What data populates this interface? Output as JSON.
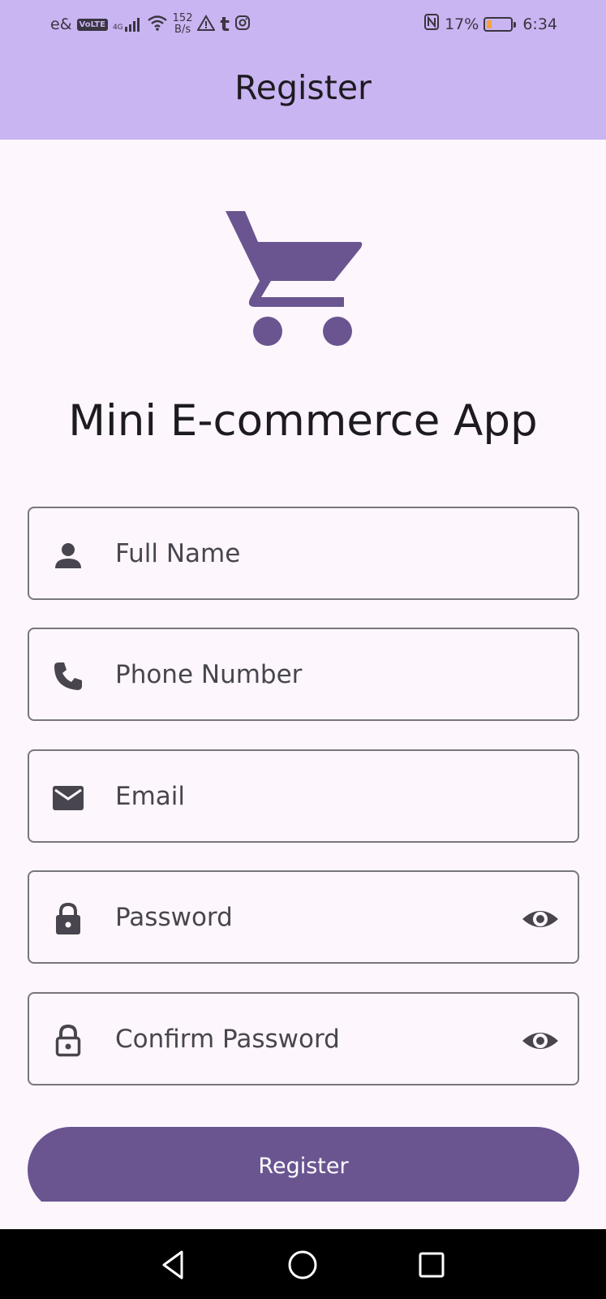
{
  "status_bar": {
    "carrier": "e&",
    "volte": "VoLTE",
    "network": "4G",
    "net_speed_value": "152",
    "net_speed_unit": "B/s",
    "battery_percent": "17%",
    "battery_level": 0.17,
    "time": "6:34",
    "icons": [
      "signal-icon",
      "wifi-icon",
      "warning-icon",
      "tumblr-icon",
      "instagram-icon",
      "nfc-icon",
      "battery-icon"
    ]
  },
  "app_bar": {
    "title": "Register"
  },
  "header": {
    "logo_icon": "shopping-cart-icon",
    "app_name": "Mini E-commerce App"
  },
  "form": {
    "full_name": {
      "placeholder": "Full Name",
      "icon": "person-icon"
    },
    "phone": {
      "placeholder": "Phone Number",
      "icon": "phone-icon"
    },
    "email": {
      "placeholder": "Email",
      "icon": "email-icon"
    },
    "password": {
      "placeholder": "Password",
      "icon": "lock-icon",
      "toggle_icon": "eye-icon"
    },
    "confirm_password": {
      "placeholder": "Confirm Password",
      "icon": "lock-outline-icon",
      "toggle_icon": "eye-icon"
    },
    "submit_label": "Register"
  },
  "colors": {
    "app_bar": "#c9b5f2",
    "background": "#fdf7fd",
    "primary": "#6a5591",
    "outline": "#79747e",
    "icon": "#49454f"
  },
  "nav": {
    "icons": [
      "back-icon",
      "home-icon",
      "recents-icon"
    ]
  }
}
